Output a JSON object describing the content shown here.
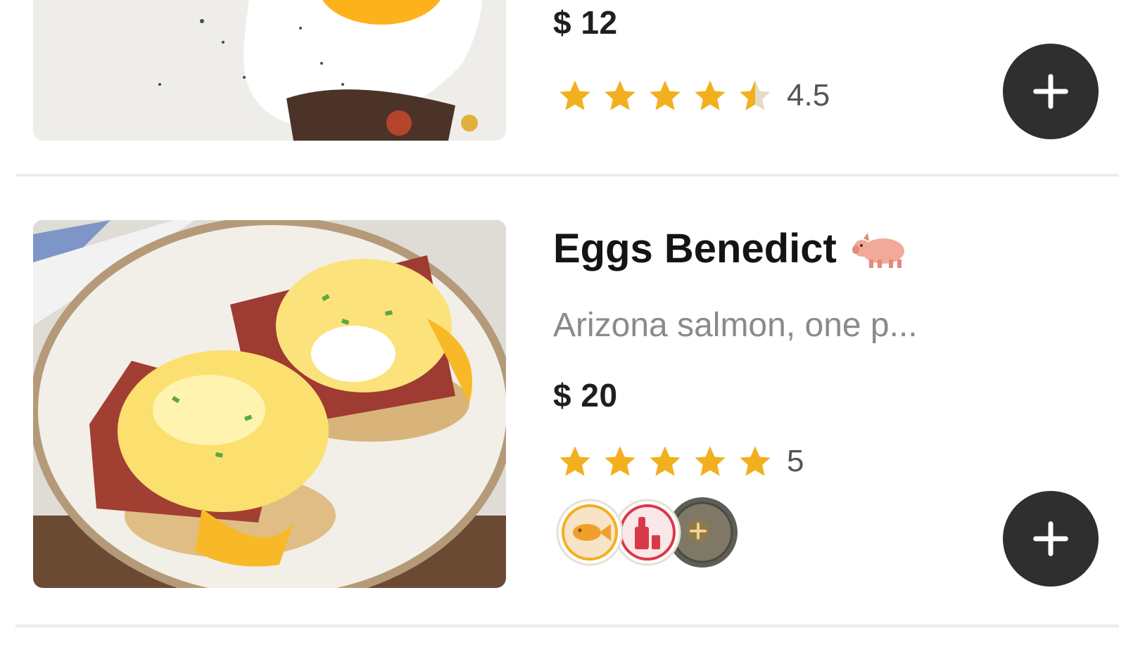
{
  "items": [
    {
      "price": "$ 12",
      "rating": "4.5",
      "stars_filled": 4.5,
      "add_icon": "plus-icon"
    },
    {
      "title": "Eggs Benedict",
      "description": "Arizona salmon, one p...",
      "price": "$ 20",
      "rating": "5",
      "stars_filled": 5,
      "title_icon": "pig-icon",
      "badges": [
        "fish-icon",
        "drink-icon",
        "more-badges-icon"
      ],
      "add_icon": "plus-icon"
    }
  ],
  "colors": {
    "star": "#f2b01e",
    "star_empty": "#e3dcc7",
    "add_button": "#2f2f2f",
    "divider": "#ececec"
  }
}
